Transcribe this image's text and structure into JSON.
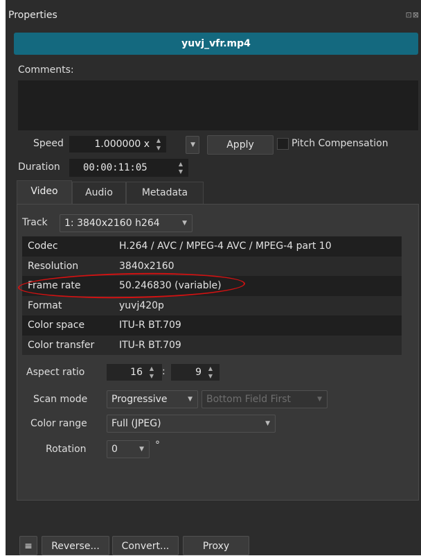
{
  "panel": {
    "title": "Properties",
    "title_buttons": "⊡⊠"
  },
  "file": {
    "name": "yuvj_vfr.mp4"
  },
  "comments": {
    "label": "Comments:",
    "value": ""
  },
  "speed": {
    "label": "Speed",
    "value": "1.000000 x",
    "apply_label": "Apply",
    "pitch_label": "Pitch Compensation",
    "pitch_checked": false
  },
  "duration": {
    "label": "Duration",
    "value": "00:00:11:05"
  },
  "tabs": [
    {
      "label": "Video",
      "active": true
    },
    {
      "label": "Audio",
      "active": false
    },
    {
      "label": "Metadata",
      "active": false
    }
  ],
  "video": {
    "track_label": "Track",
    "track_value": "1: 3840x2160 h264",
    "properties": [
      {
        "key": "Codec",
        "value": "H.264 / AVC / MPEG-4 AVC / MPEG-4 part 10"
      },
      {
        "key": "Resolution",
        "value": "3840x2160"
      },
      {
        "key": "Frame rate",
        "value": "50.246830 (variable)"
      },
      {
        "key": "Format",
        "value": "yuvj420p"
      },
      {
        "key": "Color space",
        "value": "ITU-R BT.709"
      },
      {
        "key": "Color transfer",
        "value": "ITU-R BT.709"
      }
    ],
    "aspect_label": "Aspect ratio",
    "aspect_w": "16",
    "aspect_sep": ":",
    "aspect_h": "9",
    "scan_label": "Scan mode",
    "scan_value": "Progressive",
    "field_order_value": "Bottom Field First",
    "range_label": "Color range",
    "range_value": "Full (JPEG)",
    "rotation_label": "Rotation",
    "rotation_value": "0",
    "rotation_unit": "°"
  },
  "bottom_toolbar": {
    "menu_icon": "≡",
    "reverse_label": "Reverse...",
    "convert_label": "Convert...",
    "proxy_label": "Proxy"
  },
  "colors": {
    "accent": "#14697f",
    "annotation": "#d11212",
    "panel_bg": "#2c2c2c"
  }
}
